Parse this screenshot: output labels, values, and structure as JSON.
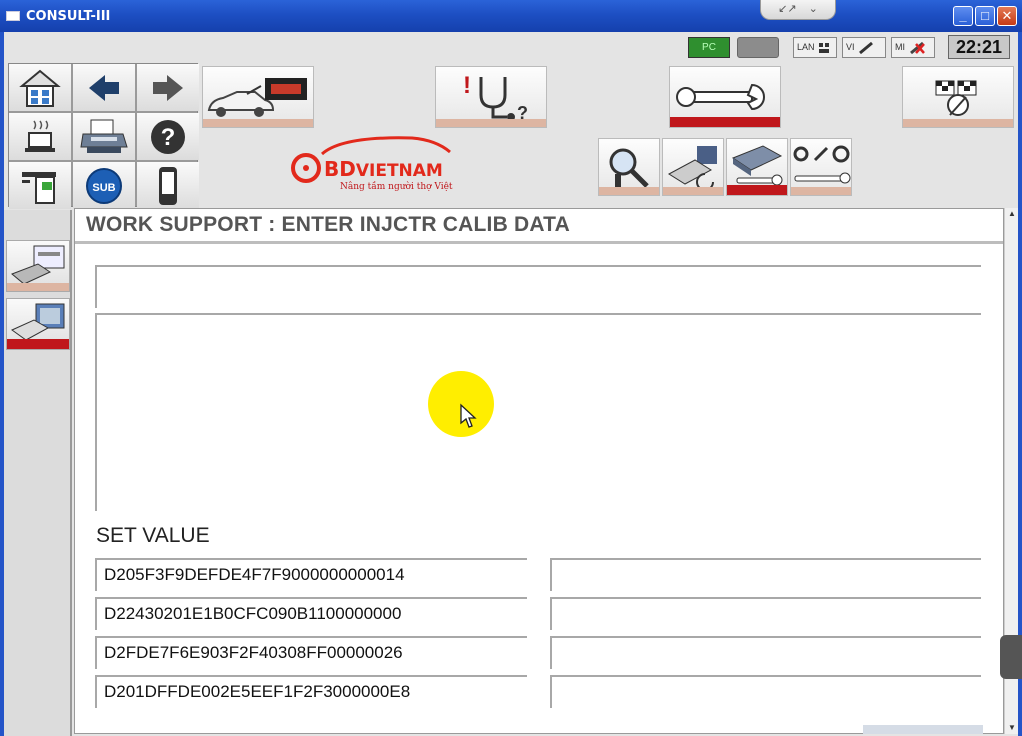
{
  "window": {
    "title": "CONSULT-III",
    "tabpull_icons": [
      "↙↗",
      "⌄"
    ]
  },
  "status": {
    "pc_label": "PC",
    "lan_label": "LAN",
    "vi_label": "VI",
    "mi_label": "MI",
    "clock": "22:21"
  },
  "logo": {
    "brand": "BDVIETNAM",
    "brand_prefix": "BD",
    "brand_suffix": "VIETNAM",
    "tagline": "Nâng tầm người thợ Việt"
  },
  "nav_grid": {
    "sub_label": "SUB"
  },
  "function_buttons": [
    {
      "name": "vehicle-data-button",
      "active": false
    },
    {
      "name": "diagnosis-button",
      "active": false
    },
    {
      "name": "work-support-button",
      "active": true
    },
    {
      "name": "finish-button",
      "active": false
    }
  ],
  "page": {
    "heading": "WORK SUPPORT : ENTER INJCTR CALIB DATA",
    "set_value_label": "SET VALUE",
    "values": [
      "D205F3F9DEFDE4F7F9000000000014",
      "D22430201E1B0CFC090B1100000000",
      "D2FDE7F6E903F2F40308FF00000026",
      "D201DFFDE002E5EEF1F2F3000000E8"
    ]
  },
  "colors": {
    "active_bar": "#c0171b",
    "inactive_bar": "#ddb5a2",
    "cursor_highlight": "#ffee00",
    "titlebar": "#1d4fc3"
  }
}
